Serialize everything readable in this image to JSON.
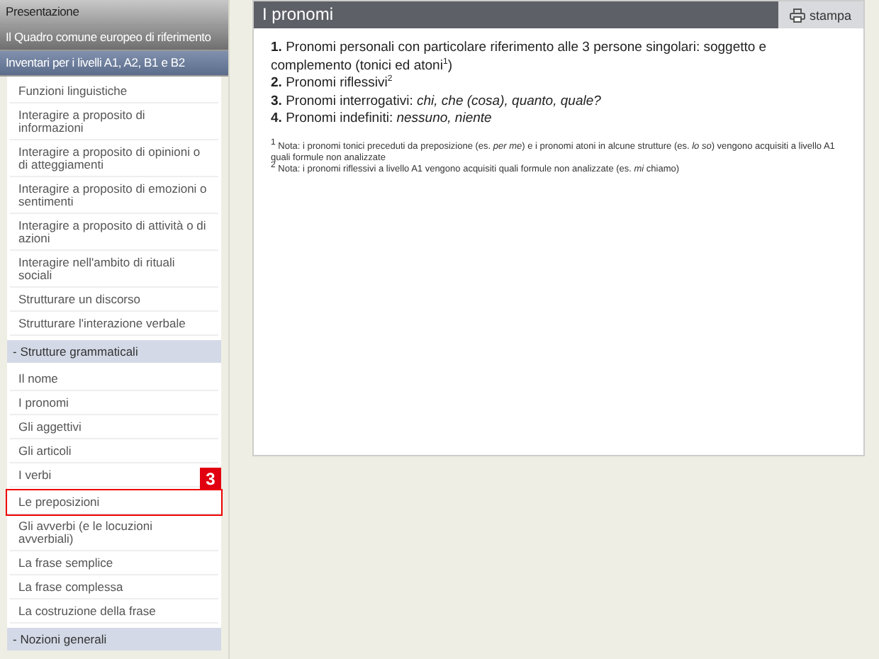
{
  "sidebar": {
    "items": [
      {
        "kind": "top",
        "label": "Presentazione",
        "selected": false
      },
      {
        "kind": "top",
        "label": "Il Quadro comune europeo di riferimento",
        "selected": false
      },
      {
        "kind": "top",
        "label": "Inventari per i livelli A1, A2, B1 e B2",
        "selected": true
      },
      {
        "kind": "item",
        "label": "Funzioni linguistiche",
        "highlighted": false
      },
      {
        "kind": "item",
        "label": "Interagire a proposito di informazioni",
        "highlighted": false
      },
      {
        "kind": "item",
        "label": "Interagire a proposito di opinioni o di atteggiamenti",
        "highlighted": false
      },
      {
        "kind": "item",
        "label": "Interagire a proposito di emozioni o sentimenti",
        "highlighted": false
      },
      {
        "kind": "item",
        "label": "Interagire a proposito di attività o di azioni",
        "highlighted": false
      },
      {
        "kind": "item",
        "label": "Interagire nell'ambito di rituali sociali",
        "highlighted": false
      },
      {
        "kind": "item",
        "label": "Strutturare un discorso",
        "highlighted": false
      },
      {
        "kind": "item",
        "label": "Strutturare l'interazione verbale",
        "highlighted": false
      },
      {
        "kind": "section",
        "label": "- Strutture grammaticali"
      },
      {
        "kind": "item",
        "label": "Il nome",
        "highlighted": false
      },
      {
        "kind": "item",
        "label": "I pronomi",
        "highlighted": false
      },
      {
        "kind": "item",
        "label": "Gli aggettivi",
        "highlighted": false
      },
      {
        "kind": "item",
        "label": "Gli articoli",
        "highlighted": false
      },
      {
        "kind": "item",
        "label": "I verbi",
        "highlighted": false
      },
      {
        "kind": "item",
        "label": "Le preposizioni",
        "highlighted": true,
        "badge": "3"
      },
      {
        "kind": "item",
        "label": "Gli avverbi (e le locuzioni avverbiali)",
        "highlighted": false
      },
      {
        "kind": "item",
        "label": "La frase semplice",
        "highlighted": false
      },
      {
        "kind": "item",
        "label": "La frase complessa",
        "highlighted": false
      },
      {
        "kind": "item",
        "label": "La costruzione della frase",
        "highlighted": false
      },
      {
        "kind": "section",
        "label": "- Nozioni generali"
      }
    ]
  },
  "content": {
    "title": "I pronomi",
    "print_button": "stampa",
    "list": [
      {
        "number": "1.",
        "text": "Pronomi personali con particolare riferimento alle 3 persone singolari: soggetto e complemento (tonici ed atoni$^{1}$)"
      },
      {
        "number": "2.",
        "text": "Pronomi riflessivi$^{2}$"
      },
      {
        "number": "3.",
        "text": "Pronomi interrogativi: *chi, che (cosa), quanto, quale?*"
      },
      {
        "number": "4.",
        "text": "Pronomi indefiniti: *nessuno, niente*"
      }
    ],
    "notes": [
      "$^{1}$ Nota: i pronomi tonici preceduti da preposizione (es. *per me*) e i pronomi atoni in alcune strutture (es. *lo so*) vengono acquisiti a livello A1 quali formule non analizzate",
      "$^{2}$ Nota: i pronomi riflessivi a livello A1 vengono acquisiti quali formule non analizzate (es. *mi* chiamo)"
    ]
  }
}
